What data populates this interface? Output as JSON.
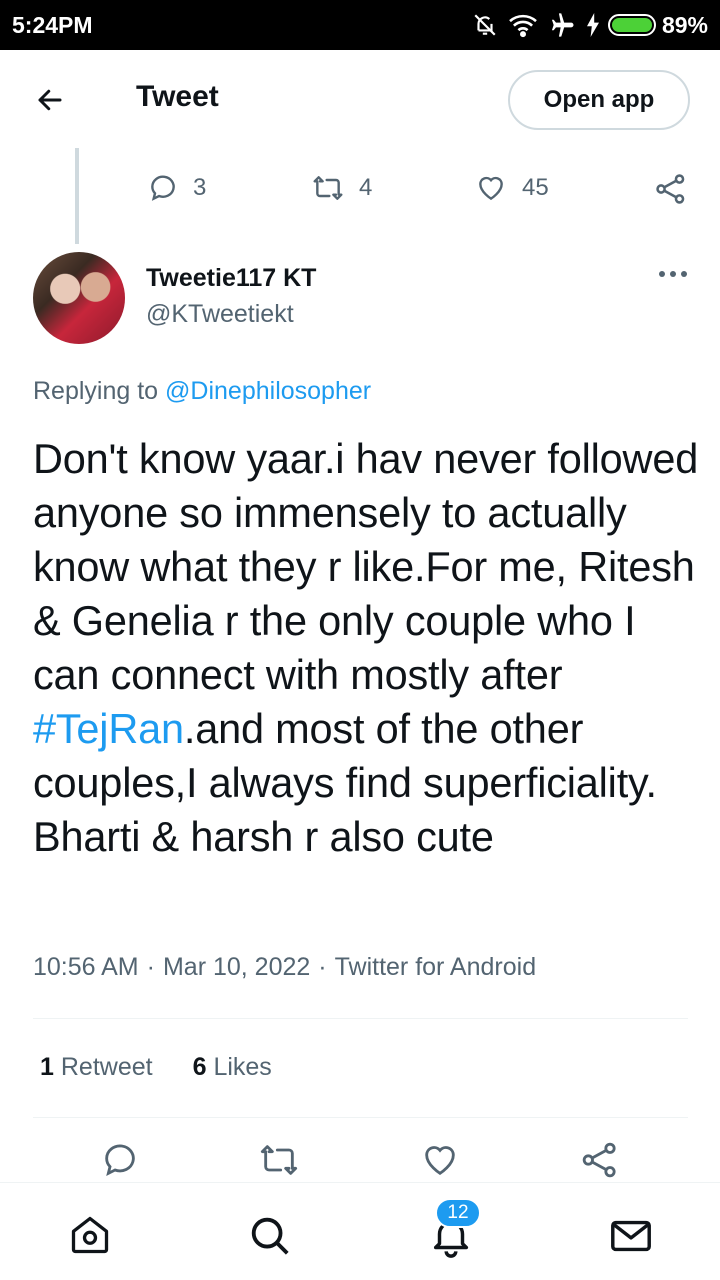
{
  "status_bar": {
    "time": "5:24PM",
    "battery": "89%",
    "icons": [
      "notifications-off-icon",
      "wifi-icon",
      "airplane-icon",
      "charging-icon",
      "battery-icon"
    ]
  },
  "header": {
    "title": "Tweet",
    "open_app_label": "Open app"
  },
  "parent_tweet_actions": {
    "replies": "3",
    "retweets": "4",
    "likes": "45"
  },
  "tweet": {
    "author_name": "Tweetie117 KT",
    "author_handle": "@KTweetiekt",
    "replying_prefix": "Replying to ",
    "replying_to": "@Dinephilosopher",
    "text_before": "Don't know yaar.i hav never followed anyone so immensely to actually know what they r like.For me, Ritesh & Genelia r the only couple who I can connect with mostly after ",
    "hashtag": "#TejRan",
    "text_after": ".and most of the other couples,I always find superficiality. Bharti & harsh r also cute",
    "time": "10:56 AM",
    "date": "Mar 10, 2022",
    "source": "Twitter for Android",
    "separator": "·"
  },
  "stats": {
    "retweet_count": "1",
    "retweet_label": "Retweet",
    "like_count": "6",
    "like_label": "Likes"
  },
  "bottom_nav": {
    "notification_badge": "12",
    "items": [
      "home-icon",
      "search-icon",
      "notifications-icon",
      "messages-icon"
    ]
  },
  "colors": {
    "accent": "#1d9bf0",
    "secondary_text": "#536471",
    "primary_text": "#0f1419",
    "divider": "#eff3f4"
  }
}
